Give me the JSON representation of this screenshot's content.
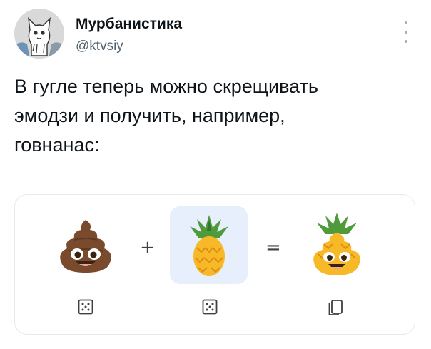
{
  "author": {
    "name": "Мурбанистика",
    "handle": "@ktvsiy"
  },
  "tweet": {
    "lines": [
      "В гугле теперь можно скрещивать",
      "эмодзи и получить, например,",
      "говнанас:"
    ]
  },
  "emoji_kitchen": {
    "left_emoji": "pile-of-poo",
    "plus": "+",
    "right_emoji": "pineapple",
    "equals": "=",
    "result": "pineapple-poo-mashup",
    "left_action": "dice-icon",
    "right_action": "dice-icon",
    "result_action": "copy-icon"
  },
  "colors": {
    "poo_brown": "#7a4a2c",
    "pineapple_yellow": "#f7b928",
    "leaf_green": "#4f9a3a",
    "slot_highlight": "#e6effb"
  }
}
